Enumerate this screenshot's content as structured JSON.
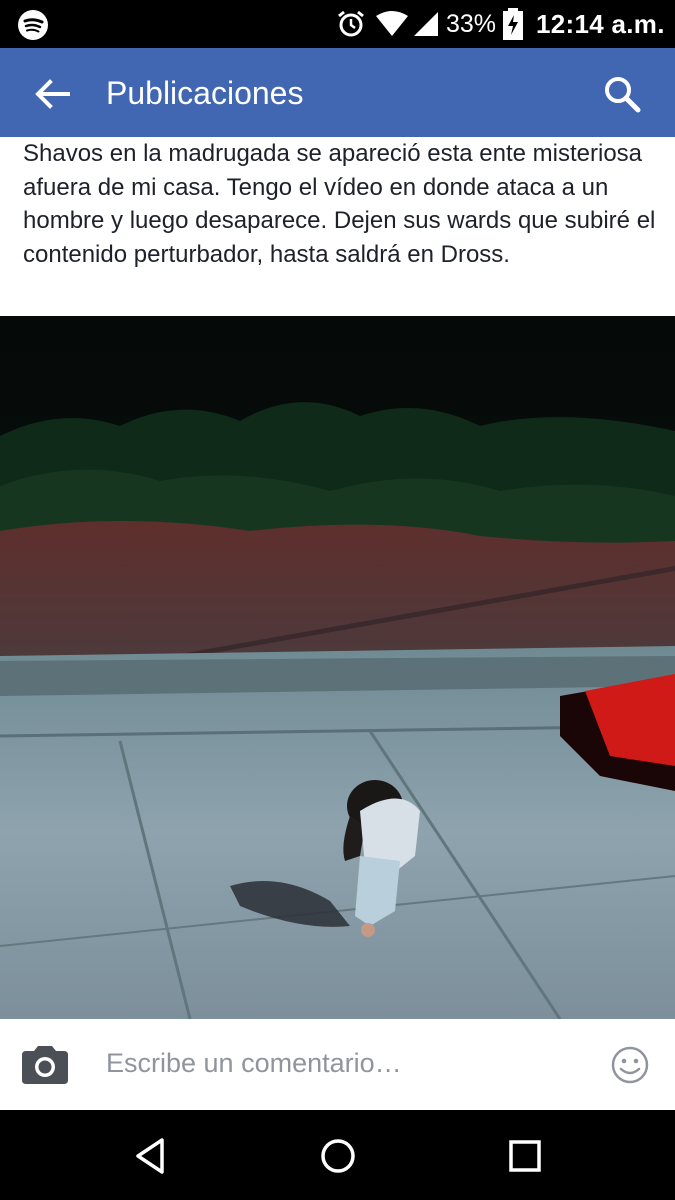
{
  "status_bar": {
    "battery_percent": "33%",
    "time": "12:14 a.m.",
    "icons": [
      "spotify-icon",
      "alarm-icon",
      "wifi-icon",
      "cell-signal-icon",
      "battery-charging-icon"
    ]
  },
  "app_bar": {
    "title": "Publicaciones",
    "back_icon": "arrow-left-icon",
    "search_icon": "search-icon",
    "color": "#4267b2"
  },
  "post": {
    "text": "Shavos en la madrugada se apareció esta ente misteriosa afuera de mi casa. Tengo el vídeo en donde ataca a un hombre y luego desaparece. Dejen sus wards que subiré el contenido perturbador, hasta saldrá en Dross."
  },
  "comment_bar": {
    "placeholder": "Escribe un comentario…",
    "camera_icon": "camera-icon",
    "emoji_icon": "smiley-icon"
  },
  "nav_bar": {
    "icons": [
      "back-triangle-icon",
      "home-circle-icon",
      "recents-square-icon"
    ]
  }
}
